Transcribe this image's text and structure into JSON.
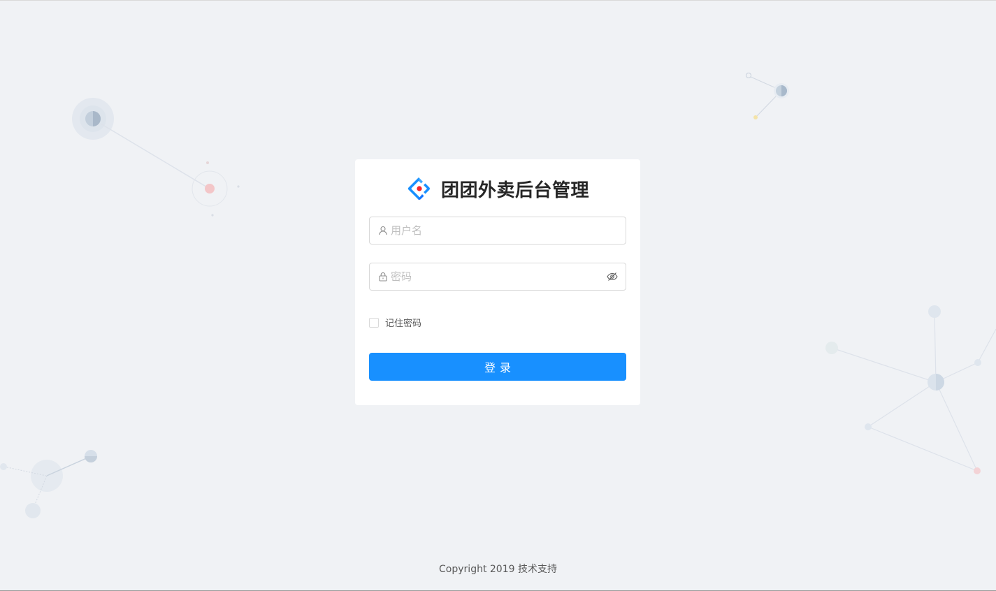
{
  "app": {
    "title": "团团外卖后台管理"
  },
  "form": {
    "username_placeholder": "用户名",
    "username_value": "",
    "password_placeholder": "密码",
    "password_value": "",
    "remember_label": "记住密码",
    "remember_checked": false,
    "submit_label": "登录"
  },
  "footer": {
    "copyright": "Copyright 2019 技术支持"
  },
  "icons": {
    "logo": "diamond-logo-icon",
    "username_prefix": "user-icon",
    "password_prefix": "lock-icon",
    "password_toggle": "eye-invisible-icon"
  },
  "colors": {
    "background": "#f0f2f5",
    "card": "#ffffff",
    "primary": "#1890ff",
    "logo_red": "#f5222d",
    "border": "#d9d9d9"
  }
}
